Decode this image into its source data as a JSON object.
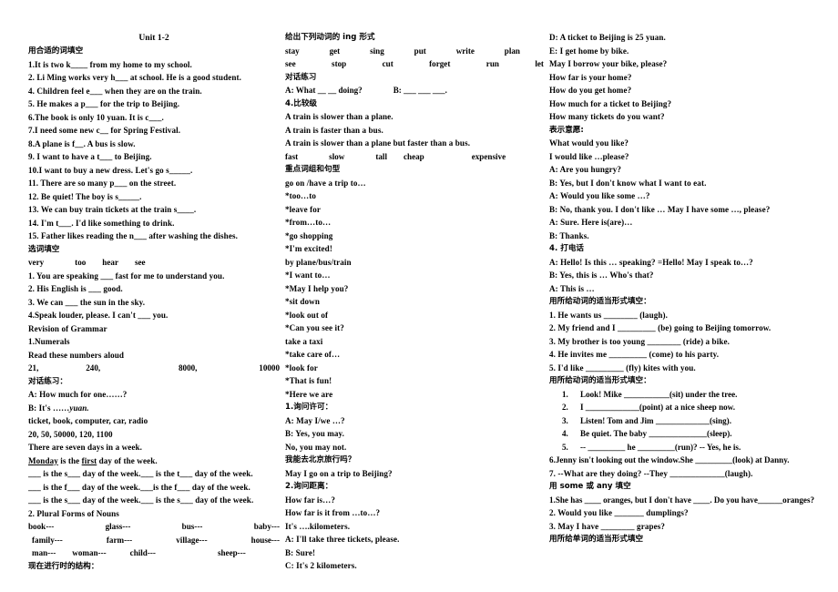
{
  "document": {
    "title": "Unit 1-2"
  },
  "column1": {
    "heading_fill_words": "用合适的词填空",
    "items": [
      "1.It is two k____ from my home to my school.",
      "2. Li Ming works very h___ at school. He is a good student.",
      "4. Children feel e___ when they are on the train.",
      "5. He makes a p___ for the trip to Beijing.",
      "6.The book is only 10 yuan. It is c___.",
      "7.I need some new c__ for Spring Festival.",
      "8.A plane is f__. A bus is slow.",
      "9. I want to have a t___ to Beijing.",
      "10.I want to buy a new dress. Let's go s_____.",
      "11. There are so many p___ on the street.",
      "12. Be quiet! The boy is s_____.",
      "13. We can buy train tickets at the train s____.",
      "14. I'm t___. I'd like something to drink.",
      "15. Father likes reading the n___ after washing the dishes."
    ],
    "heading_word_choice": "选词填空",
    "word_bank": [
      "very",
      "too",
      "hear",
      "see"
    ],
    "word_choice_items": [
      "1. You are speaking ___ fast for me to understand you.",
      "2. His English is ___ good.",
      "3. We can ___ the sun in the sky.",
      "4.Speak louder, please. I can't ___ you."
    ],
    "grammar_heading": "Revision of Grammar",
    "numerals_heading": "1.Numerals",
    "read_numbers_label": "Read these numbers aloud",
    "numbers": [
      "21,",
      "240,",
      "8000,",
      "10000"
    ],
    "dialog_practice_heading": "对话练习：",
    "dialog_lines": [
      "A: How much for one……?",
      "B: It's ……"
    ],
    "dialog_yuan": "yuan.",
    "noun_list": "ticket, book, computer, car, radio",
    "number_list": "20, 50, 50000, 120, 1100",
    "week_intro": "There are seven days in a week.",
    "monday_line": {
      "word1": "Monday",
      "mid": " is the ",
      "word2": "first",
      "end": " day of the week."
    },
    "week_blanks": [
      "___ is the s___ day of the week.___ is the t___ day of the week.",
      "___ is the f___ day of the week.___is the f___ day of the week.",
      "___ is the s___ day of the week.___ is the s___ day of the week."
    ],
    "plural_heading": "2. Plural Forms of Nouns",
    "plural_rows": [
      [
        "book---",
        "glass---",
        "bus---",
        "baby---"
      ],
      [
        "family---",
        "farm---",
        "village---",
        "house---"
      ],
      [
        "man---",
        "woman---",
        "child---",
        "sheep---"
      ]
    ],
    "present_continuous_heading": "现在进行时的结构："
  },
  "column2": {
    "ing_heading": "给出下列动词的 ing 形式",
    "verbs_row1": [
      "stay",
      "get",
      "sing",
      "put",
      "write",
      "plan"
    ],
    "verbs_row2": [
      "see",
      "stop",
      "cut",
      "forget",
      "run",
      "let"
    ],
    "dialog_practice_heading": "对话练习",
    "dialog_line": "A: What __ __ doing?",
    "dialog_line_b": "B: ___ ___ ___.",
    "comparative_heading": "4.比较级",
    "comparative_examples": [
      "A train is slower than a plane.",
      "A train is faster than a bus.",
      "A train is slower than a plane but faster than a bus."
    ],
    "adjectives": [
      "fast",
      "slow",
      "tall",
      "cheap",
      "expensive"
    ],
    "phrases_heading": "重点词组和句型",
    "phrases": [
      "go on /have a trip to…",
      "*too…to",
      "*leave for",
      "*from…to…",
      "*go shopping",
      "*I'm excited!",
      "by plane/bus/train",
      "*I want to…",
      "*May I help you?",
      "*sit down",
      "*look out of",
      "*Can you see it?",
      "take a taxi",
      "*take care of…",
      "*look for",
      "*That is fun!",
      "*Here we are"
    ],
    "ask_permission_heading": "1.询问许可：",
    "ask_permission_lines": [
      "A: May I/we …?",
      "B: Yes, you may.",
      "No, you may not."
    ],
    "permission_cjk": "我能去北京旅行吗？",
    "permission_en": "May I go on a trip to Beijing?",
    "ask_distance_heading": "2.询问距离：",
    "ask_distance_lines": [
      "How far is…?",
      "How far is it from …to…?",
      "It's ….kilometers.",
      "A: I'll take three tickets, please.",
      "B: Sure!",
      "C: It's 2 kilometers."
    ]
  },
  "column3": {
    "lines_top": [
      "D: A ticket to Beijing is 25 yuan.",
      "E: I get home by bike.",
      "May I borrow your bike, please?",
      "How far is your home?",
      "How do you get home?",
      "How much for a ticket to Beijing?",
      "How many tickets do you want?"
    ],
    "express_wish_heading": "表示意愿:",
    "wish_lines": [
      "What would you like?",
      "I would like …please?",
      "A: Are you hungry?",
      "B: Yes, but I don't know what I want to eat.",
      "A: Would you like some …?",
      "B: No, thank you. I don't like … May I have some …, please?",
      "A: Sure. Here is(are)…",
      "B: Thanks."
    ],
    "phone_heading": "4. 打电话",
    "phone_lines": [
      "A: Hello! Is this  … speaking? =Hello! May I speak to…?",
      "B: Yes, this is … Who's that?",
      "A: This is …"
    ],
    "verb_form_heading_1": "用所给动词的适当形式填空：",
    "verb_items_1": [
      "1. He wants us ________ (laugh).",
      "2. My friend and I _________ (be) going to Beijing tomorrow.",
      "3. My brother is too young ________ (ride) a bike.",
      "4. He invites me _________ (come) to his party.",
      "5. I'd like _________ (fly) kites with you."
    ],
    "verb_form_heading_2": "用所给动词的适当形式填空：",
    "verb_items_2": [
      {
        "num": "1.",
        "text": "Look! Mike ___________(sit) under the tree."
      },
      {
        "num": "2.",
        "text": "I _____________(point) at a nice sheep now."
      },
      {
        "num": "3.",
        "text": "Listen! Tom and Jim _____________(sing)."
      },
      {
        "num": "4.",
        "text": "Be quiet. The baby ______________(sleep)."
      },
      {
        "num": "5.",
        "text": "-- _________ he _________(run)?    -- Yes, he is."
      }
    ],
    "item6": "6.Jenny isn't looking out the window.She _________(look) at Danny.",
    "item7": "7. --What are they doing?    --They _____________(laugh).",
    "some_any_heading": "用 some 或 any 填空",
    "some_any_items": [
      "1.She has ____ oranges, but I don't have ____. Do you have______oranges?",
      "2. Would you like _______ dumplings?",
      "3. May I have ________ grapes?"
    ],
    "word_form_heading": "用所给单词的适当形式填空"
  }
}
